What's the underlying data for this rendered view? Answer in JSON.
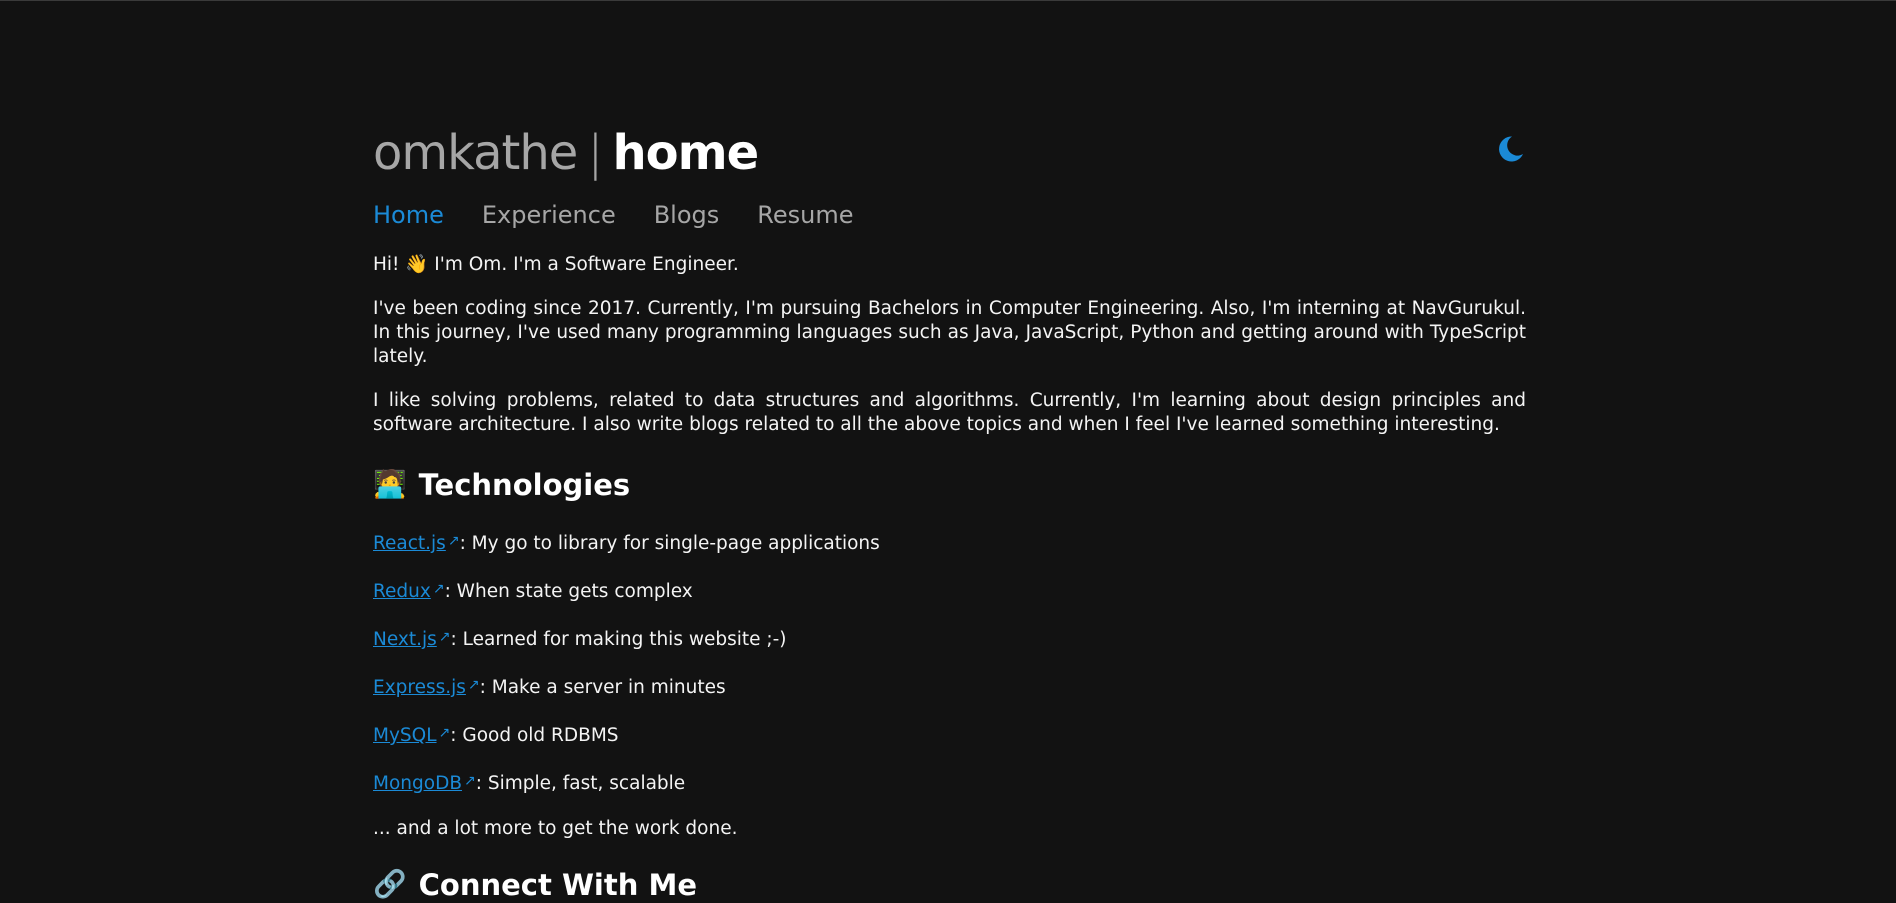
{
  "header": {
    "brand_name": "omkathe",
    "brand_separator": "|",
    "brand_page": "home",
    "theme_toggle_icon": "moon-icon"
  },
  "nav": {
    "items": [
      {
        "label": "Home",
        "active": true
      },
      {
        "label": "Experience",
        "active": false
      },
      {
        "label": "Blogs",
        "active": false
      },
      {
        "label": "Resume",
        "active": false
      }
    ]
  },
  "intro": {
    "greeting_before": "Hi!",
    "greeting_emoji": "👋",
    "greeting_after": "I'm Om. I'm a Software Engineer.",
    "paragraph_1": "I've been coding since 2017. Currently, I'm pursuing Bachelors in Computer Engineering. Also, I'm interning at NavGurukul. In this journey, I've used many programming languages such as Java, JavaScript, Python and getting around with TypeScript lately.",
    "paragraph_2": "I like solving problems, related to data structures and algorithms. Currently, I'm learning about design principles and software architecture. I also write blogs related to all the above topics and when I feel I've learned something interesting."
  },
  "technologies": {
    "emoji": "🧑‍💻",
    "heading": "Technologies",
    "items": [
      {
        "name": "React.js",
        "desc": ": My go to library for single-page applications"
      },
      {
        "name": "Redux",
        "desc": ": When state gets complex"
      },
      {
        "name": "Next.js",
        "desc": ": Learned for making this website ;-)"
      },
      {
        "name": "Express.js",
        "desc": ": Make a server in minutes"
      },
      {
        "name": "MySQL",
        "desc": ": Good old RDBMS"
      },
      {
        "name": "MongoDB",
        "desc": ": Simple, fast, scalable"
      }
    ],
    "more": "... and a lot more to get the work done."
  },
  "connect": {
    "emoji": "🔗",
    "heading": "Connect With Me"
  },
  "colors": {
    "background": "#121212",
    "accent": "#1b8ad6",
    "muted": "#a6a6a6",
    "text": "#f4f4f4"
  }
}
